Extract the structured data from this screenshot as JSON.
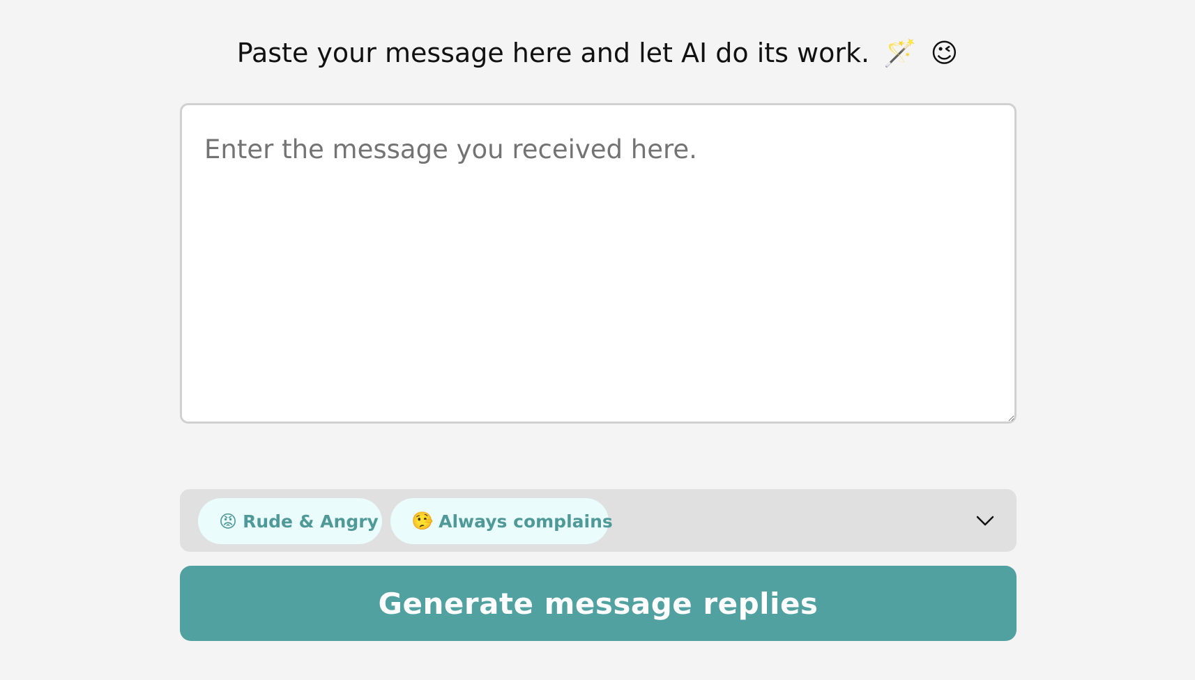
{
  "header": {
    "title": "Paste your message here and let AI do its work.",
    "emoji_wand": "🪄",
    "emoji_wink": "😉"
  },
  "message_input": {
    "placeholder": "Enter the message you received here.",
    "value": ""
  },
  "tags": [
    {
      "emoji": "😡",
      "label": "Rude & Angry"
    },
    {
      "emoji": "🤥",
      "label": "Always complains"
    }
  ],
  "generate_button": {
    "label": "Generate message replies"
  },
  "icons": {
    "dropdown": "chevron-down-icon"
  },
  "colors": {
    "background": "#f4f4f4",
    "accent": "#51a1a0",
    "chip_background": "#eafcfc",
    "chip_text": "#4f9a99",
    "tag_bar_background": "#e0e0e0"
  }
}
